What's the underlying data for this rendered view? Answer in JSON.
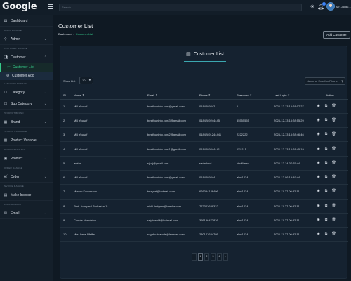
{
  "app": {
    "logo": "Google"
  },
  "topbar": {
    "search_placeholder": "Search",
    "notification_count": "4",
    "user_name": "Mr. Jaydu..."
  },
  "sidebar": {
    "dashboard": "Dashboard",
    "section_admin": "ADMIN MANAGE",
    "admin": "Admin",
    "section_customer": "CUSTOMER MANAGE",
    "customer": "Customer",
    "customer_list": "Customer List",
    "customer_add": "Customer Add",
    "section_category": "CATEGORY MANAGE",
    "category": "Category",
    "sub_category": "Sub Category",
    "section_brand": "PRODUCT BRAND",
    "brand": "Brand",
    "section_variable": "PRODUCT VARIABLE",
    "product_variable": "Product Variable",
    "section_product": "PRODUCT MANAGE",
    "product": "Product",
    "section_order": "ORDER MANAGE",
    "order": "Order",
    "section_invoice": "INVOICE MANAGE",
    "make_invoice": "Make Invoice",
    "section_email": "EMAIL MANAGE",
    "email": "Email"
  },
  "page": {
    "title": "Customer List",
    "breadcrumb_home": "Dashboard",
    "breadcrumb_sep": "/",
    "breadcrumb_current": "Customer List",
    "add_button": "Add Customer"
  },
  "card": {
    "title": "Customer List",
    "show_label": "Show List",
    "show_value": "10",
    "search_placeholder": "Name or Email or Phone"
  },
  "table": {
    "headers": [
      "SL",
      "Name ⇕",
      "Email ⇕",
      "Phone ⇕",
      "Password ⇕",
      "Last Login ⇕",
      "Action"
    ],
    "rows": [
      [
        "1",
        "MD Yousuf",
        "bestfouninfo.com@gmail.com",
        "0184289242",
        "1",
        "2024-12-13 15:28:07:27"
      ],
      [
        "2",
        "MD Yousuf",
        "bestfouninfo.com3@gmail.com",
        "0184289244445",
        "55555555",
        "2024-12-13 15:28:55:29"
      ],
      [
        "3",
        "MD Yousuf",
        "bestfouninfo.com2@gmail.com",
        "01842891244441",
        "2222222",
        "2024-12-13 15:28:46:46"
      ],
      [
        "4",
        "MD Yousuf",
        "bestfouninfo.com1@gmail.com",
        "0184289244441",
        "1111111",
        "2024-12-13 15:28:45:19"
      ],
      [
        "5",
        "amtan",
        "sjsdj@gmail.com",
        "sadadasd",
        "fdsdf4ew4",
        "2024-12-14 07:25:44"
      ],
      [
        "6",
        "MD Yousuf",
        "bestfouninfo.com@gmail.com",
        "0184289244",
        "akm1234",
        "2024-12-06 19:49:44"
      ],
      [
        "7",
        "Morton Kertzmann",
        "tmayert@hotmail.com",
        "626094146406",
        "akm1234",
        "2024-11-27 00:32:11"
      ],
      [
        "8",
        "Prof. Johnpaul Prohaska Jr.",
        "nikki.lindgren@brekke.com",
        "773323639332",
        "akm1234",
        "2024-11-27 00:32:11"
      ],
      [
        "9",
        "Connie Hermiston",
        "ralph.wolff@hotmail.com",
        "395196472836",
        "akm1234",
        "2024-11-27 00:32:11"
      ],
      [
        "10",
        "Mrs. Irene Pfeffer",
        "rogahn.brandle@lemmer.com",
        "230147634705",
        "akm1234",
        "2024-11-27 00:32:11"
      ]
    ]
  },
  "pagination": [
    "‹",
    "1",
    "2",
    "3",
    "4",
    "›"
  ],
  "icons": {
    "view": "eye-icon",
    "edit": "edit-icon",
    "delete": "trash-icon"
  },
  "colors": {
    "background": "#0f1923",
    "accent_green": "#35c98b",
    "accent_teal": "#3ba7b0",
    "badge_blue": "#3b82f6"
  }
}
